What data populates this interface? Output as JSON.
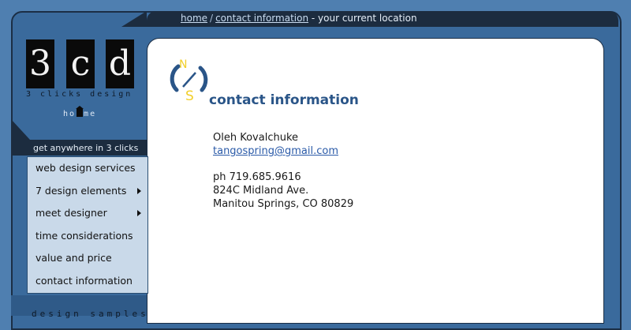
{
  "breadcrumb": {
    "home": "home",
    "separator": "/",
    "contact": "contact information",
    "location": "- your current location"
  },
  "logo": {
    "letters": [
      "3",
      "c",
      "d"
    ],
    "subtitle": "3 clicks design"
  },
  "home_link": {
    "before": "ho",
    "after": "me"
  },
  "nav": {
    "heading": "get anywhere in 3 clicks",
    "items": [
      {
        "label": "web design services",
        "has_submenu": false
      },
      {
        "label": "7 design elements",
        "has_submenu": true
      },
      {
        "label": "meet designer",
        "has_submenu": true
      },
      {
        "label": "time considerations",
        "has_submenu": false
      },
      {
        "label": "value and price",
        "has_submenu": false
      },
      {
        "label": "contact information",
        "has_submenu": false
      }
    ],
    "samples_label": "design samples"
  },
  "compass": {
    "north": "N",
    "south": "S"
  },
  "main": {
    "title": "contact information",
    "name": "Oleh Kovalchuke",
    "email": "tangospring@gmail.com",
    "phone": "ph 719.685.9616",
    "address1": "824C Midland Ave.",
    "address2": "Manitou Springs, CO 80829"
  },
  "colors": {
    "background": "#4f7fb0",
    "frame": "#3a6a9c",
    "dark_bar": "#1c2c3f",
    "nav_panel": "#c9d9e9",
    "title": "#2a5588",
    "compass_accent": "#f2cf2a"
  }
}
